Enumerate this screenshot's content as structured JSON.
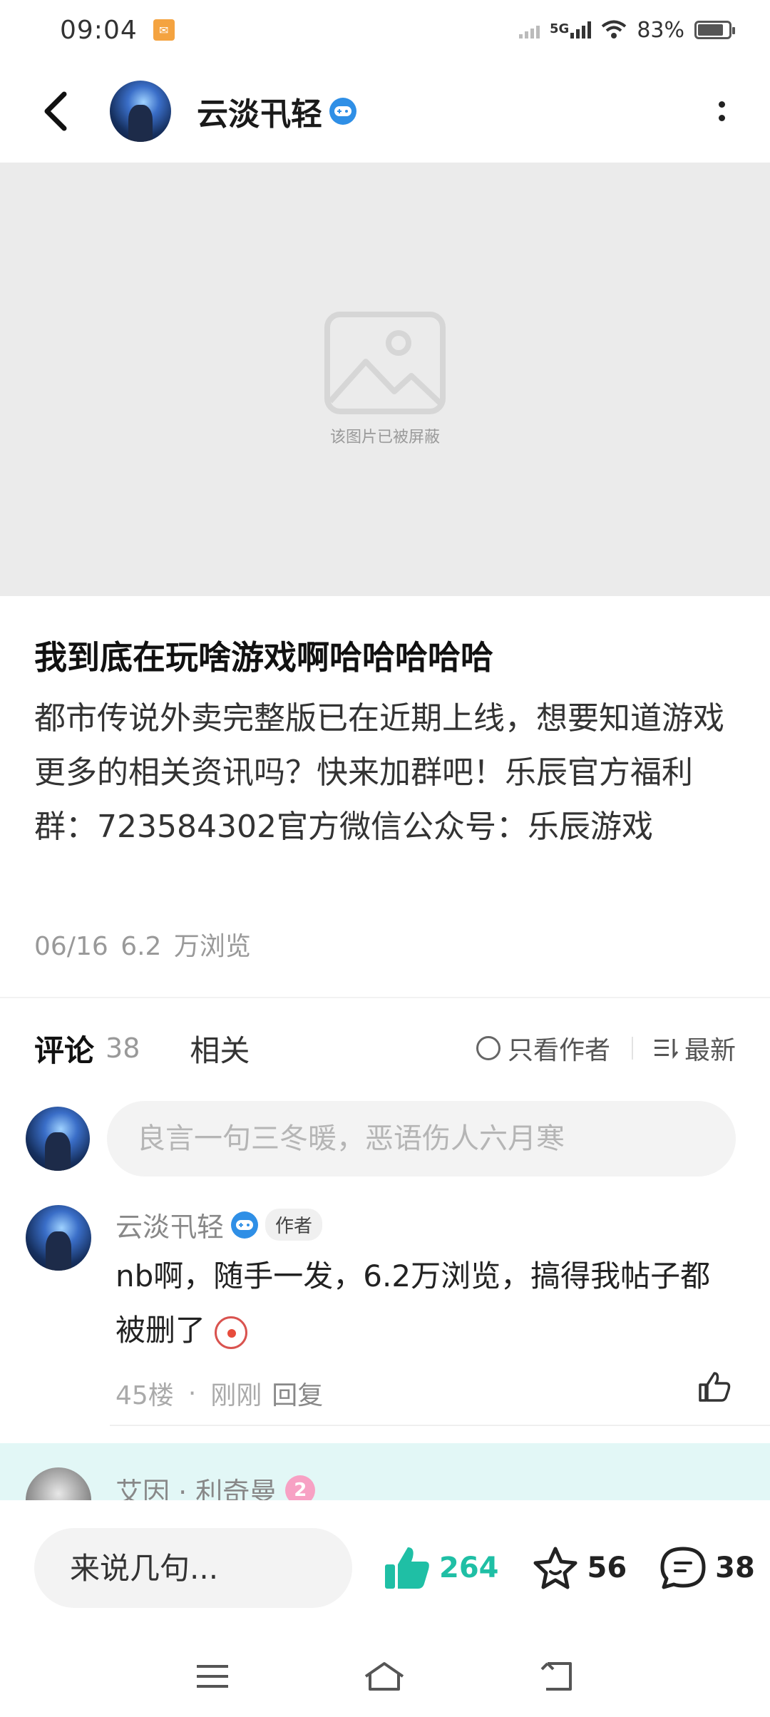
{
  "status_bar": {
    "time": "09:04",
    "network": "5G",
    "battery": "83%"
  },
  "header": {
    "username": "云淡卂轻"
  },
  "blocked_image": {
    "text": "该图片已被屏蔽"
  },
  "post": {
    "title": "我到底在玩啥游戏啊哈哈哈哈哈",
    "body": "都市传说外卖完整版已在近期上线，想要知道游戏更多的相关资讯吗？快来加群吧！乐辰官方福利群：723584302官方微信公众号：乐辰游戏",
    "date": "06/16",
    "views": "6.2 万浏览"
  },
  "tabs": {
    "comments_label": "评论",
    "comments_count": "38",
    "related_label": "相关",
    "author_only_label": "只看作者",
    "sort_label": "最新"
  },
  "comment_input": {
    "placeholder": "良言一句三冬暖，恶语伤人六月寒"
  },
  "comments": [
    {
      "username": "云淡卂轻",
      "tag": "作者",
      "text": "nb啊，随手一发，6.2万浏览，搞得我帖子都被删了",
      "floor": "45楼",
      "time": "刚刚",
      "reply_label": "回复"
    }
  ],
  "next_comment": {
    "username": "艾因 · 利奇曼",
    "level": "2"
  },
  "bottom_bar": {
    "input_placeholder": "来说几句...",
    "likes": "264",
    "favorites": "56",
    "comments": "38",
    "accent_color": "#1fbfa5"
  }
}
